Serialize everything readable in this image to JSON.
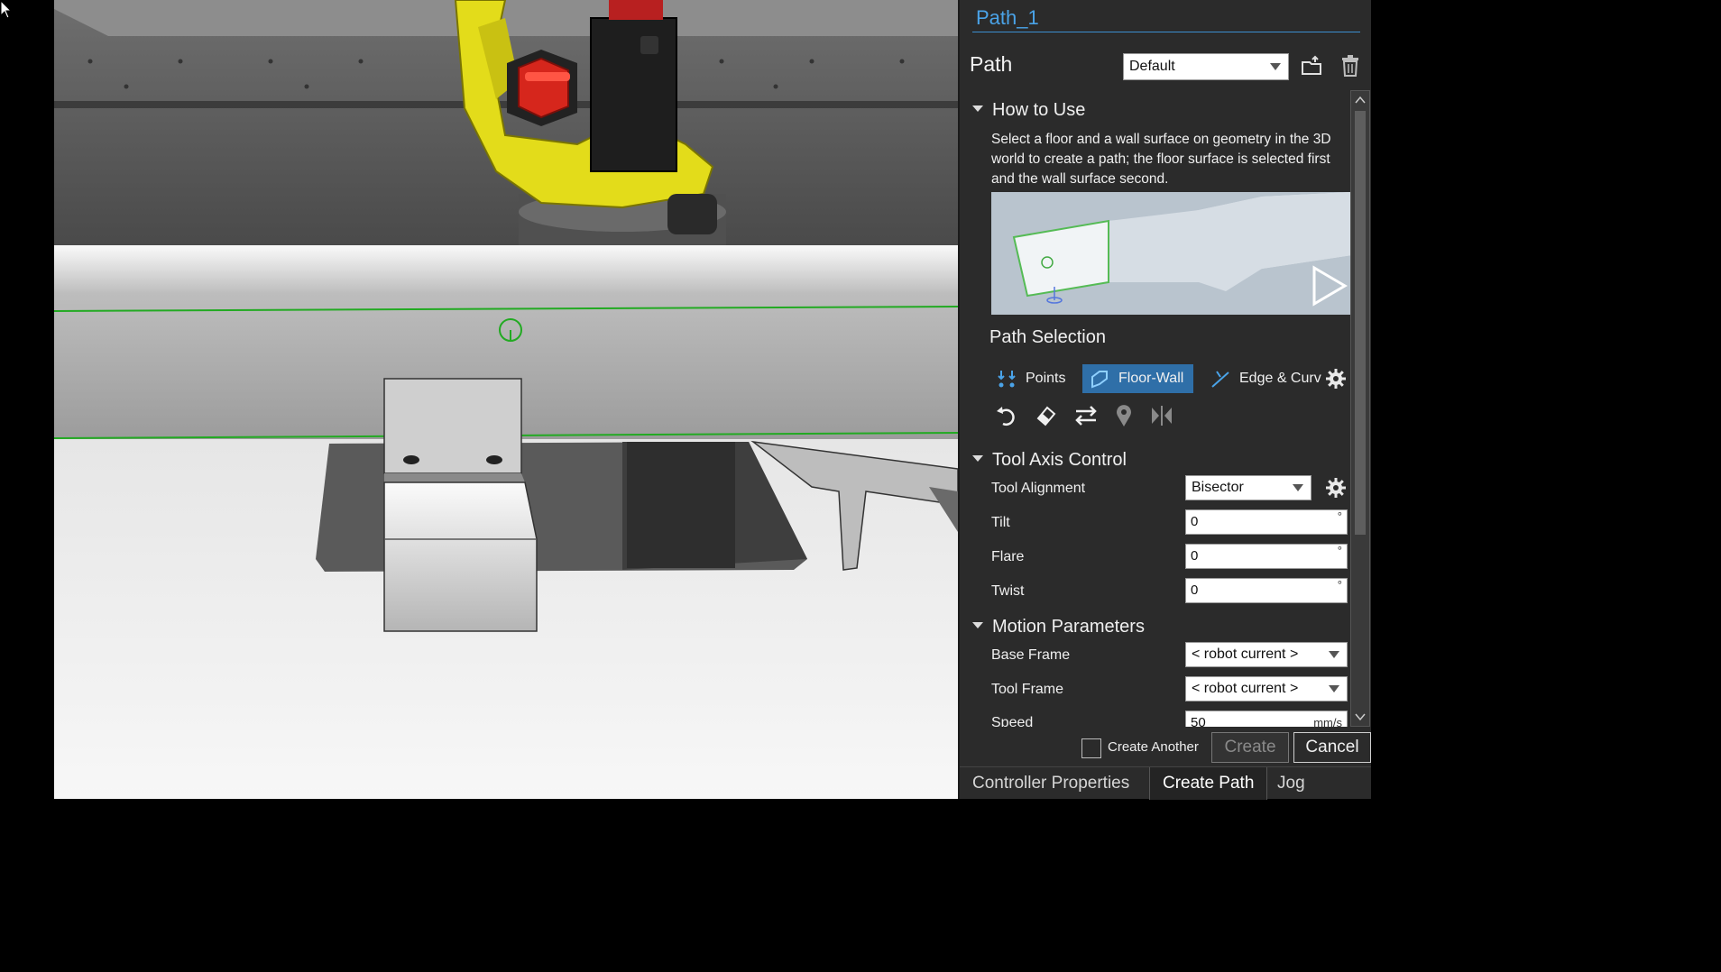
{
  "panel": {
    "title": "Path_1",
    "path_label": "Path",
    "path_select": "Default",
    "icons": {
      "load": "folder-open-icon",
      "delete": "trash-icon"
    },
    "how_to_use": {
      "heading": "How to Use",
      "text": "Select a floor and a wall surface on geometry in the 3D world to create a path; the floor surface is selected first and the wall surface second."
    },
    "path_selection": {
      "heading": "Path Selection",
      "modes": [
        {
          "label": "Points",
          "icon": "points-icon",
          "active": false
        },
        {
          "label": "Floor-Wall",
          "icon": "floor-wall-icon",
          "active": true
        },
        {
          "label": "Edge & Curv",
          "icon": "edge-curve-icon",
          "active": false
        }
      ],
      "tools": [
        "undo-icon",
        "eraser-icon",
        "swap-icon",
        "location-pin-icon",
        "mirror-icon"
      ]
    },
    "tool_axis": {
      "heading": "Tool Axis Control",
      "alignment_label": "Tool Alignment",
      "alignment_value": "Bisector",
      "tilt_label": "Tilt",
      "tilt_value": "0",
      "flare_label": "Flare",
      "flare_value": "0",
      "twist_label": "Twist",
      "twist_value": "0",
      "angle_unit": "°"
    },
    "motion": {
      "heading": "Motion Parameters",
      "base_frame_label": "Base Frame",
      "base_frame_value": "< robot current >",
      "tool_frame_label": "Tool Frame",
      "tool_frame_value": "< robot current >",
      "speed_label": "Speed",
      "speed_value": "50",
      "speed_unit": "mm/s"
    },
    "create_another_label": "Create Another",
    "create_label": "Create",
    "cancel_label": "Cancel",
    "tabs": [
      "Controller Properties",
      "Create Path",
      "Jog"
    ]
  },
  "colors": {
    "accent": "#3b8fd1",
    "active_mode": "#2f6fa8",
    "path_line": "#22aa22",
    "robot_yellow": "#e3dc1a"
  }
}
